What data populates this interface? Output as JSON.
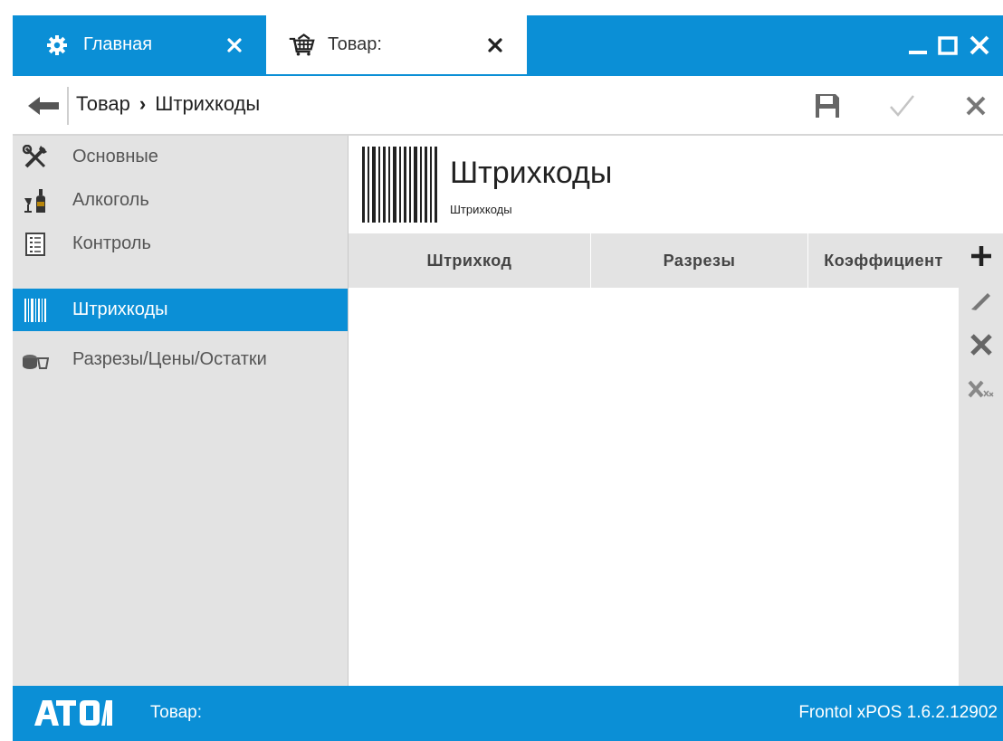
{
  "colors": {
    "accent": "#0b8fd6",
    "sidebar_bg": "#e3e3e3",
    "active_item": "#0b8fd6",
    "text": "#222222"
  },
  "titlebar": {
    "tabs": [
      {
        "icon": "gear-icon",
        "label": "Главная",
        "close_icon": "close-icon"
      },
      {
        "icon": "basket-icon",
        "label": "Товар:",
        "close_icon": "close-icon"
      }
    ],
    "window_controls": [
      "minimize-icon",
      "maximize-icon",
      "close-icon"
    ]
  },
  "breadcrumb": {
    "back_icon": "back-arrow-icon",
    "parent": "Товар",
    "separator": "›",
    "current": "Штрихкоды",
    "toolbar": [
      "save-icon",
      "checkmark-icon",
      "cancel-icon"
    ]
  },
  "sidebar": {
    "items": [
      {
        "label": "Основные",
        "icon": "tools-icon"
      },
      {
        "label": "Алкоголь",
        "icon": "bottle-glass-icon"
      },
      {
        "label": "Контроль",
        "icon": "checklist-icon"
      },
      {
        "label": "Штрихкоды",
        "icon": "barcode-icon",
        "active": true
      },
      {
        "label": "Разрезы/Цены/Остатки",
        "icon": "coins-icon"
      }
    ]
  },
  "main": {
    "title": "Штрихкоды",
    "subtitle": "Штрихкоды",
    "grid": {
      "columns": [
        "Штрихкод",
        "Разрезы",
        "Коэффициент"
      ],
      "rows": []
    },
    "row_actions": [
      "add-icon",
      "edit-icon",
      "delete-icon",
      "delete-all-icon"
    ]
  },
  "status": {
    "logo": "АТОЛ",
    "document": "Товар:",
    "version": "Frontol xPOS 1.6.2.12902"
  }
}
